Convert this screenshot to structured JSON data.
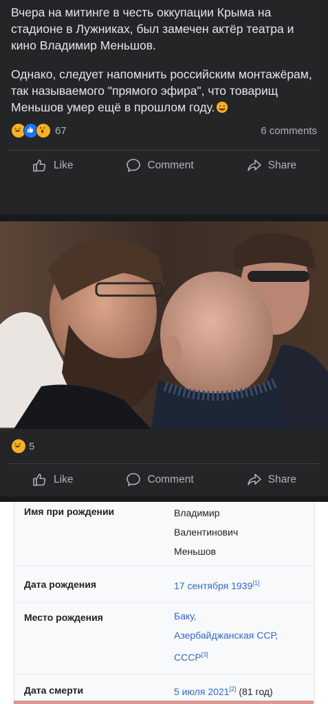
{
  "post1": {
    "paragraph1": "Вчера на митинге в честь оккупации Крыма на стадионе в Лужниках, был замечен актёр театра и кино Владимир Меньшов.",
    "paragraph2": "Однако, следует напомнить российским монтажёрам, так называемого \"прямого эфира\", что товарищ Меньшов умер ещё в прошлом году.",
    "reaction_count": "67",
    "comments": "6 comments",
    "actions": {
      "like": "Like",
      "comment": "Comment",
      "share": "Share"
    }
  },
  "post2": {
    "reaction_count": "5",
    "actions": {
      "like": "Like",
      "comment": "Comment",
      "share": "Share"
    }
  },
  "infobox": {
    "rows": [
      {
        "label": "Имя при рождении",
        "value_lines": [
          "Владимир",
          "Валентинович",
          "Меньшов"
        ]
      },
      {
        "label": "Дата рождения",
        "value": "17 сентября 1939",
        "ref": "[1]"
      },
      {
        "label": "Место рождения",
        "value_lines": [
          "Баку,",
          "Азербайджанская ССР,",
          "СССР"
        ],
        "ref": "[3]"
      },
      {
        "label": "Дата смерти",
        "value": "5 июля 2021",
        "ref": "[2]",
        "extra": " (81 год)"
      }
    ]
  },
  "colors": {
    "background": "#18191a",
    "card": "#242526",
    "text": "#e4e6eb",
    "muted": "#b0b3b8",
    "link": "#3366cc"
  }
}
